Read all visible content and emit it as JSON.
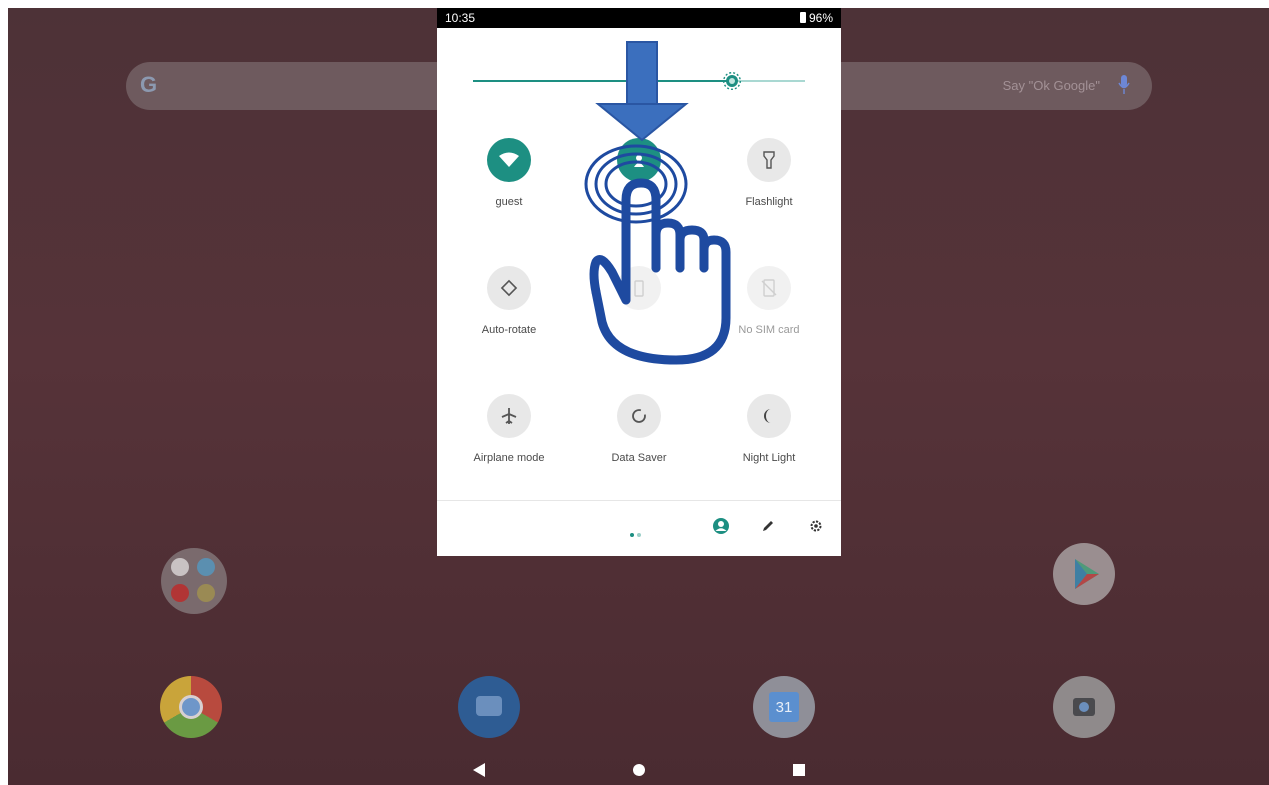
{
  "status_bar": {
    "time": "10:35",
    "battery": "96%"
  },
  "brightness": {
    "level": 0.78
  },
  "tiles": [
    {
      "label": "guest",
      "icon": "wifi-icon",
      "state": "on"
    },
    {
      "label": "",
      "icon": "hotspot-icon",
      "state": "on"
    },
    {
      "label": "Flashlight",
      "icon": "flashlight-icon",
      "state": "off"
    },
    {
      "label": "Auto-rotate",
      "icon": "auto-rotate-icon",
      "state": "off"
    },
    {
      "label": "",
      "icon": "battery-saver-icon",
      "state": "unavailable"
    },
    {
      "label": "",
      "sublabel": "No SIM card",
      "icon": "mobile-data-icon",
      "state": "unavailable"
    },
    {
      "label": "Airplane mode",
      "icon": "airplane-icon",
      "state": "off"
    },
    {
      "label": "Data Saver",
      "icon": "data-saver-icon",
      "state": "off"
    },
    {
      "label": "Night Light",
      "icon": "night-light-icon",
      "state": "off"
    }
  ],
  "footer": {
    "page": 1,
    "pages": 2,
    "icons": [
      "user-icon",
      "edit-icon",
      "settings-icon"
    ]
  },
  "home": {
    "search_hint": "Say \"Ok Google\"",
    "apps": []
  },
  "colors": {
    "accent": "#1d8f82",
    "annotation": "#1e4aa0",
    "arrow": "#3b6fbe"
  }
}
